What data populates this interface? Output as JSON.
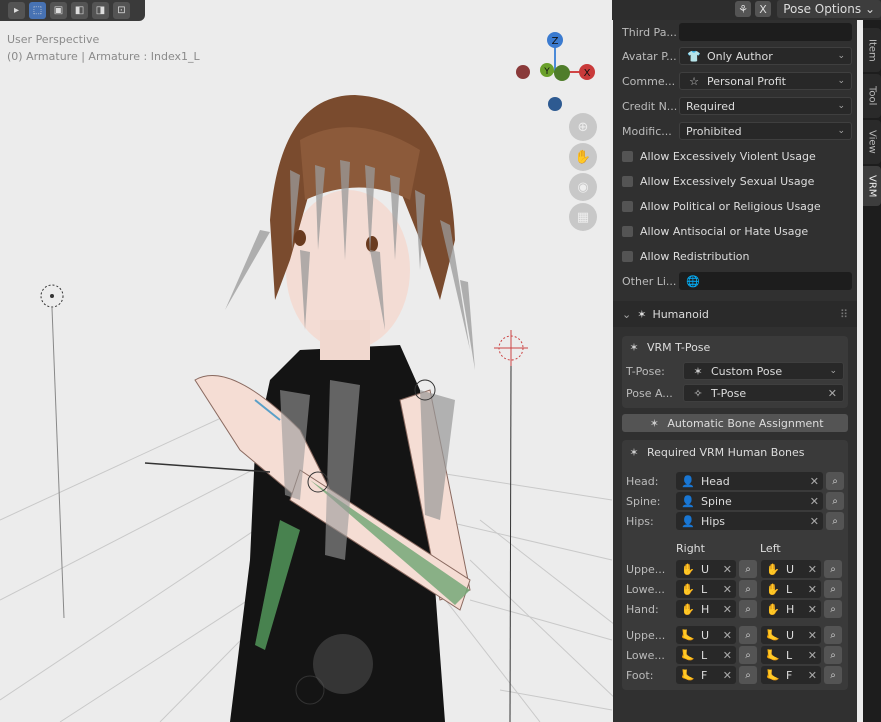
{
  "viewport": {
    "perspective_label": "User Perspective",
    "object_label": "(0) Armature | Armature : Index1_L",
    "gizmo": {
      "z": "Z",
      "y": "Y",
      "x": "X"
    }
  },
  "header": {
    "pose_options": "Pose Options",
    "close_x": "X"
  },
  "tabs": [
    "Item",
    "Tool",
    "View",
    "VRM"
  ],
  "license": {
    "third_party_label": "Third Pa...",
    "third_party_value": "",
    "avatar_perm_label": "Avatar P...",
    "avatar_perm_value": "Only Author",
    "commercial_label": "Comme...",
    "commercial_value": "Personal Profit",
    "credit_label": "Credit N...",
    "credit_value": "Required",
    "modification_label": "Modific...",
    "modification_value": "Prohibited",
    "checks": [
      "Allow Excessively Violent Usage",
      "Allow Excessively Sexual Usage",
      "Allow Political or Religious Usage",
      "Allow Antisocial or Hate Usage",
      "Allow Redistribution"
    ],
    "other_label": "Other Li...",
    "other_value": ""
  },
  "humanoid": {
    "title": "Humanoid",
    "tpose_title": "VRM T-Pose",
    "tpose_label": "T-Pose:",
    "tpose_value": "Custom Pose",
    "pose_action_label": "Pose A...",
    "pose_action_value": "T-Pose",
    "auto_assign": "Automatic Bone Assignment",
    "required_title": "Required VRM Human Bones",
    "head_label": "Head:",
    "head_value": "Head",
    "spine_label": "Spine:",
    "spine_value": "Spine",
    "hips_label": "Hips:",
    "hips_value": "Hips",
    "right_header": "Right",
    "left_header": "Left",
    "arm_rows": [
      {
        "label": "Uppe...",
        "right": "U",
        "left": "U"
      },
      {
        "label": "Lowe...",
        "right": "L",
        "left": "L"
      },
      {
        "label": "Hand:",
        "right": "H",
        "left": "H"
      }
    ],
    "leg_rows": [
      {
        "label": "Uppe...",
        "right": "U",
        "left": "U"
      },
      {
        "label": "Lowe...",
        "right": "L",
        "left": "L"
      },
      {
        "label": "Foot:",
        "right": "F",
        "left": "F"
      }
    ]
  }
}
